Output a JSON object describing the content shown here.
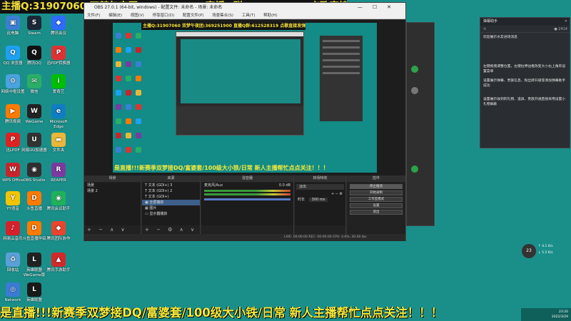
{
  "banner_top": "主播Q:31907060 双梦午夜团:369251900 直播Q群:612528319 点歌直接发弹幕!",
  "banner_bottom": "是直播!!!新赛季双梦接DQ/富婆套/100级大小铁/日常 新人主播帮忙点点关注！！！",
  "desktop_icons": [
    {
      "label": "此电脑",
      "color": "#3b7fd4",
      "glyph": "▣"
    },
    {
      "label": "Steam",
      "color": "#1b2838",
      "glyph": "S"
    },
    {
      "label": "腾讯会议",
      "color": "#2f6bff",
      "glyph": "◆"
    },
    {
      "label": "QQ 浏览器",
      "color": "#1da1f2",
      "glyph": "Q"
    },
    {
      "label": "腾讯QQ",
      "color": "#111",
      "glyph": "Q"
    },
    {
      "label": "迅PDF转换器",
      "color": "#d33",
      "glyph": "P"
    },
    {
      "label": "网络中枢设置",
      "color": "#4aa3df",
      "glyph": "⚙"
    },
    {
      "label": "微信",
      "color": "#2aae67",
      "glyph": "✉"
    },
    {
      "label": "爱奇艺",
      "color": "#00be06",
      "glyph": "i"
    },
    {
      "label": "腾讯视频",
      "color": "#ff7a00",
      "glyph": "▶"
    },
    {
      "label": "WeGame",
      "color": "#222",
      "glyph": "W"
    },
    {
      "label": "Microsoft Edge",
      "color": "#0f7dc2",
      "glyph": "e"
    },
    {
      "label": "迅LPDF",
      "color": "#d22",
      "glyph": "P"
    },
    {
      "label": "网易UU加速器",
      "color": "#333",
      "glyph": "U"
    },
    {
      "label": "文件夹",
      "color": "#e9b73a",
      "glyph": "▬"
    },
    {
      "label": "WPS Office",
      "color": "#c9242b",
      "glyph": "W"
    },
    {
      "label": "OBS Studio",
      "color": "#302e31",
      "glyph": "◉"
    },
    {
      "label": "REAPER",
      "color": "#7b3aa0",
      "glyph": "R"
    },
    {
      "label": "YY语音",
      "color": "#f5c400",
      "glyph": "Y"
    },
    {
      "label": "斗鱼直播",
      "color": "#ff7a00",
      "glyph": "D"
    },
    {
      "label": "腾讯会议助手",
      "color": "#20b25a",
      "glyph": "◉"
    },
    {
      "label": "网易云音乐",
      "color": "#d6212c",
      "glyph": "♪"
    },
    {
      "label": "斗鱼直播伴侣",
      "color": "#ff7a00",
      "glyph": "D"
    },
    {
      "label": "腾讯团队协作",
      "color": "#e9452e",
      "glyph": "◆"
    },
    {
      "label": "回收站",
      "color": "#5aa0d8",
      "glyph": "♻"
    },
    {
      "label": "英雄联盟WeGame版",
      "color": "#222",
      "glyph": "L"
    },
    {
      "label": "腾讯手游助手",
      "color": "#d02a2a",
      "glyph": "▲"
    },
    {
      "label": "Network",
      "color": "#3a7bd5",
      "glyph": "◎"
    },
    {
      "label": "英雄联盟",
      "color": "#1a1a1a",
      "glyph": "L"
    }
  ],
  "obs": {
    "title": "OBS 27.0.1 (64-bit, windows) - 配置文件: 未命名 - 场景: 未命名",
    "menu": [
      "文件(F)",
      "编辑(E)",
      "视图(V)",
      "停靠窗口(D)",
      "配置文件(P)",
      "场景集合(S)",
      "工具(T)",
      "帮助(H)"
    ],
    "nested_banner": "主播Q:31907060 双梦午夜团:369251900 直播Q群:612528319 点歌直接发弹幕!",
    "nested_bottom": "是直播!!!新赛季双梦接DQ/富婆套/100级大小铁/日常 新人主播帮忙点点关注！！！",
    "panels": {
      "scenes": {
        "title": "场景",
        "items": [
          "场景",
          "场景 2"
        ]
      },
      "sources": {
        "title": "来源",
        "items": [
          "文本 (GDI+) 3",
          "文本 (GDI+) 2",
          "文本 (GDI+)",
          "全屏捕获",
          "图片",
          "显示器捕获"
        ]
      },
      "mixer": {
        "title": "混音器",
        "device": "麦克风/Aux",
        "level": "0.0 dB"
      },
      "transitions": {
        "title": "转场特效",
        "type": "淡出",
        "duration_label": "时长",
        "duration": "300 ms"
      },
      "controls": {
        "title": "控件",
        "buttons": [
          "停止推流",
          "开始录制",
          "工作室模式",
          "设置",
          "退出"
        ]
      }
    },
    "status": "LIVE: 00:00:00   REC: 00:00:00   CPU: 4.6%, 30.00 fps"
  },
  "chat": {
    "title": "弹幕助手",
    "count": "2414",
    "messages": [
      "欢迎展示水友进场消息",
      "左键拖拽调整位置，左键拉伸边框改变大小右上角有设置菜单",
      "设置展示弹幕、贵族信息、粉丝牌升级等添加弹幕助手成功",
      "设置展示收到的礼物、道具、贵族开通直接采用设置小礼物屏蔽"
    ]
  },
  "weather": {
    "temp": "23",
    "up": "4.1 K/s",
    "down": "5.5 K/s"
  },
  "clock": {
    "time": "23:20",
    "date": "2022/3/29"
  }
}
